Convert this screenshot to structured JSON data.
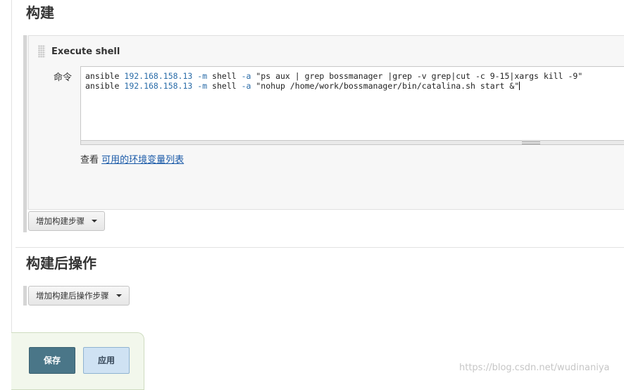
{
  "section_build": {
    "title": "构建"
  },
  "execute_shell": {
    "title": "Execute shell",
    "command_label": "命令",
    "command_lines": [
      [
        "ansible ",
        "192.168.158.13",
        " ",
        "-m",
        " shell ",
        "-a",
        " \"ps aux | grep bossmanager |grep -v grep|cut -c 9-15|xargs kill -9\""
      ],
      [
        "ansible ",
        "192.168.158.13",
        " ",
        "-m",
        " shell ",
        "-a",
        " \"nohup /home/work/bossmanager/bin/catalina.sh start &\""
      ]
    ],
    "env_prefix": "查看 ",
    "env_link": "可用的环境变量列表"
  },
  "add_build_step": {
    "label": "增加构建步骤"
  },
  "section_post_build": {
    "title": "构建后操作"
  },
  "add_post_build_step": {
    "label": "增加构建后操作步骤"
  },
  "footer": {
    "save_label": "保存",
    "apply_label": "应用"
  },
  "watermark": "https://blog.csdn.net/wudinaniya"
}
